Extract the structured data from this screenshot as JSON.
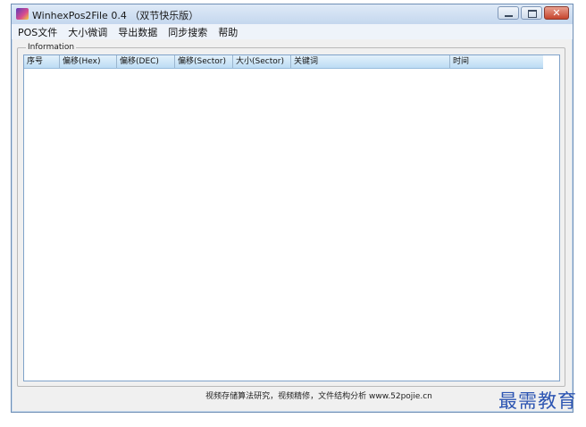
{
  "window": {
    "title": "WinhexPos2File  0.4 （双节快乐版）",
    "controls": {
      "minimize": "minimize",
      "maximize": "maximize",
      "close": "✕"
    }
  },
  "menu": [
    "POS文件",
    "大小微调",
    "导出数据",
    "同步搜索",
    "帮助"
  ],
  "group": {
    "label": "Information"
  },
  "table": {
    "columns": [
      "序号",
      "偏移(Hex)",
      "偏移(DEC)",
      "偏移(Sector)",
      "大小(Sector)",
      "关键词",
      "时间"
    ],
    "rows": []
  },
  "status": "视频存储算法研究，视频精修，文件结构分析 www.52pojie.cn",
  "watermark": "最需教育",
  "colors": {
    "title_bg": "#c7daee",
    "header_bg": "#bcdcf4",
    "close_btn": "#c6442d",
    "watermark": "#2d55b2"
  }
}
